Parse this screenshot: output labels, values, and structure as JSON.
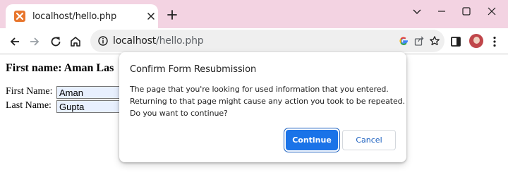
{
  "tab": {
    "title": "localhost/hello.php",
    "favicon": "xampp-icon"
  },
  "address_bar": {
    "host": "localhost",
    "path": "/hello.php"
  },
  "page": {
    "heading": "First name: Aman Las",
    "first_name_label": "First Name:",
    "first_name_value": "Aman",
    "last_name_label": "Last Name:",
    "last_name_value": "Gupta"
  },
  "dialog": {
    "title": "Confirm Form Resubmission",
    "body_lines": [
      "The page that you're looking for used information that you entered.",
      "Returning to that page might cause any action you took to be repeated.",
      "Do you want to continue?"
    ],
    "continue_label": "Continue",
    "cancel_label": "Cancel"
  },
  "colors": {
    "tabstrip_bg": "#f3d3e2",
    "accent": "#1a73e8",
    "favicon": "#e8762d",
    "input_autofill_bg": "#e8f0fe"
  }
}
